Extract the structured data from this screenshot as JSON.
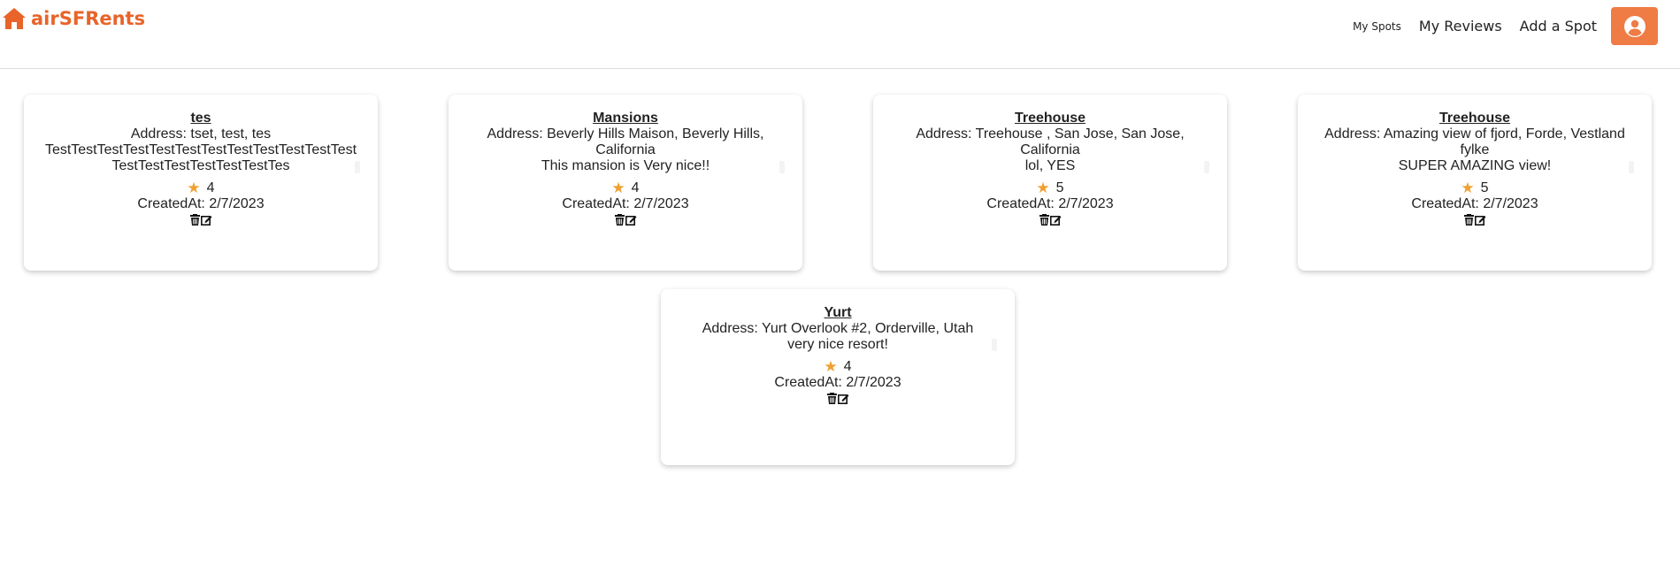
{
  "header": {
    "brand": "airSFRents",
    "nav": {
      "my_spots": "My Spots",
      "my_reviews": "My Reviews",
      "add_spot": "Add a Spot"
    },
    "icons": {
      "brand_icon": "home-icon",
      "profile_icon": "user-circle-icon"
    },
    "colors": {
      "brand": "#e8642a",
      "profile_button": "#ef7b45",
      "star": "#f0a030"
    }
  },
  "reviews": [
    {
      "spot": "tes",
      "address": "Address: tset, test, tes",
      "description": "TestTestTestTestTestTestTestTestTestTestTestTestTestTestTestTestTestTestTes",
      "rating": "4",
      "created": "CreatedAt: 2/7/2023"
    },
    {
      "spot": "Mansions",
      "address": "Address: Beverly Hills Maison, Beverly Hills, California",
      "description": "This mansion is Very nice!!",
      "rating": "4",
      "created": "CreatedAt: 2/7/2023"
    },
    {
      "spot": "Treehouse",
      "address": "Address: Treehouse , San Jose, San Jose, California",
      "description": "lol, YES",
      "rating": "5",
      "created": "CreatedAt: 2/7/2023"
    },
    {
      "spot": "Treehouse",
      "address": "Address: Amazing view of fjord, Forde, Vestland fylke",
      "description": "SUPER AMAZING view!",
      "rating": "5",
      "created": "CreatedAt: 2/7/2023"
    },
    {
      "spot": "Yurt",
      "address": "Address: Yurt Overlook #2, Orderville, Utah",
      "description": "very nice resort!",
      "rating": "4",
      "created": "CreatedAt: 2/7/2023"
    }
  ]
}
